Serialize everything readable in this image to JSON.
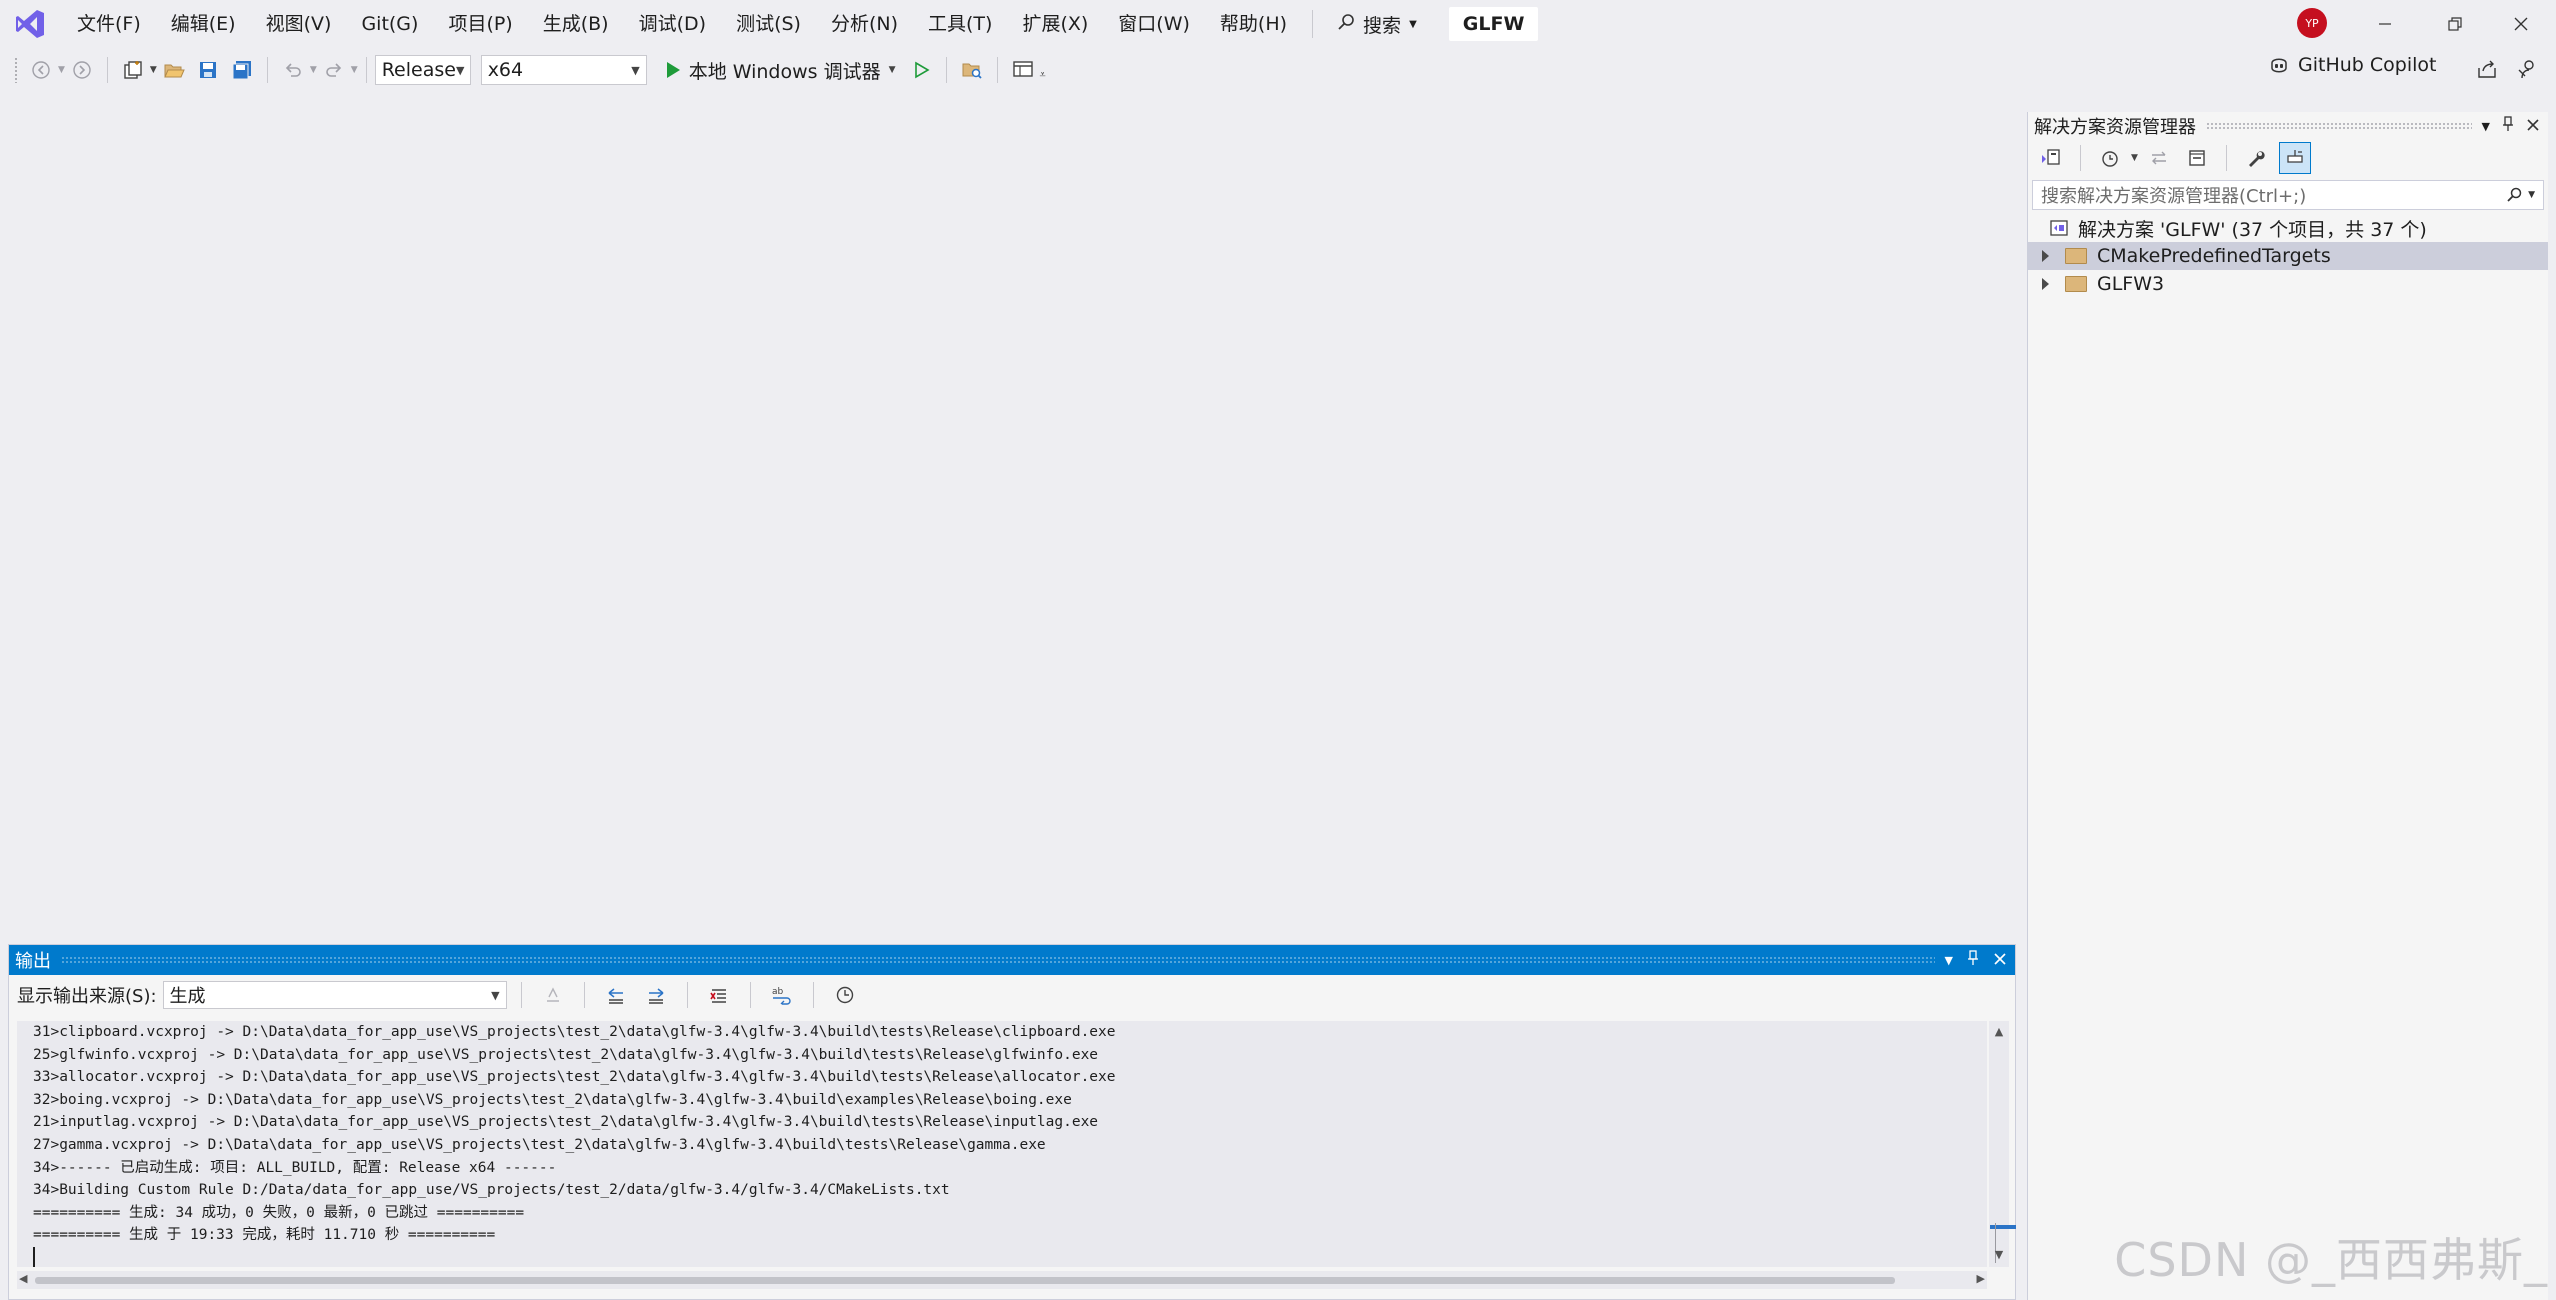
{
  "menu": {
    "items": [
      "文件(F)",
      "编辑(E)",
      "视图(V)",
      "Git(G)",
      "项目(P)",
      "生成(B)",
      "调试(D)",
      "测试(S)",
      "分析(N)",
      "工具(T)",
      "扩展(X)",
      "窗口(W)",
      "帮助(H)"
    ],
    "search_label": "搜索",
    "solution_name": "GLFW",
    "avatar_initials": "YP"
  },
  "toolbar": {
    "config": "Release",
    "platform": "x64",
    "run_label": "本地 Windows 调试器",
    "copilot_label": "GitHub Copilot"
  },
  "solution_explorer": {
    "title": "解决方案资源管理器",
    "search_placeholder": "搜索解决方案资源管理器(Ctrl+;)",
    "solution_label": "解决方案 'GLFW' (37 个项目，共 37 个)",
    "items": [
      "CMakePredefinedTargets",
      "GLFW3"
    ]
  },
  "output": {
    "title": "输出",
    "source_label": "显示输出来源(S):",
    "source_value": "生成",
    "lines": [
      "31>clipboard.vcxproj -> D:\\Data\\data_for_app_use\\VS_projects\\test_2\\data\\glfw-3.4\\glfw-3.4\\build\\tests\\Release\\clipboard.exe",
      "25>glfwinfo.vcxproj -> D:\\Data\\data_for_app_use\\VS_projects\\test_2\\data\\glfw-3.4\\glfw-3.4\\build\\tests\\Release\\glfwinfo.exe",
      "33>allocator.vcxproj -> D:\\Data\\data_for_app_use\\VS_projects\\test_2\\data\\glfw-3.4\\glfw-3.4\\build\\tests\\Release\\allocator.exe",
      "32>boing.vcxproj -> D:\\Data\\data_for_app_use\\VS_projects\\test_2\\data\\glfw-3.4\\glfw-3.4\\build\\examples\\Release\\boing.exe",
      "21>inputlag.vcxproj -> D:\\Data\\data_for_app_use\\VS_projects\\test_2\\data\\glfw-3.4\\glfw-3.4\\build\\tests\\Release\\inputlag.exe",
      "27>gamma.vcxproj -> D:\\Data\\data_for_app_use\\VS_projects\\test_2\\data\\glfw-3.4\\glfw-3.4\\build\\tests\\Release\\gamma.exe",
      "34>------ 已启动生成: 项目: ALL_BUILD, 配置: Release x64 ------",
      "34>Building Custom Rule D:/Data/data_for_app_use/VS_projects/test_2/data/glfw-3.4/glfw-3.4/CMakeLists.txt",
      "========== 生成: 34 成功，0 失败，0 最新，0 已跳过 ==========",
      "========== 生成 于 19:33 完成，耗时 11.710 秒 =========="
    ]
  },
  "watermark": "CSDN @_西西弗斯_",
  "colors": {
    "accent": "#007acc",
    "background": "#eeeef2",
    "run_green": "#1e9b3a",
    "logo_purple": "#7160e8"
  }
}
